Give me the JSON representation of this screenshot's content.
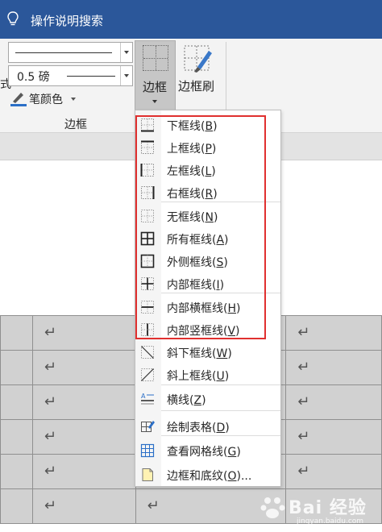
{
  "titlebar": {
    "title": "操作说明搜索",
    "icon": "lightbulb-icon"
  },
  "ribbon": {
    "style_fragment": "式",
    "pen_weight": "0.5 磅",
    "pen_color_label": "笔颜色",
    "borders_button_label": "边框",
    "border_painter_label": "边框刷",
    "group_label": "边框"
  },
  "borders_menu": {
    "items": [
      {
        "label": "下框线",
        "accel": "B",
        "icon": "bottom-border-icon"
      },
      {
        "label": "上框线",
        "accel": "P",
        "icon": "top-border-icon"
      },
      {
        "label": "左框线",
        "accel": "L",
        "icon": "left-border-icon"
      },
      {
        "label": "右框线",
        "accel": "R",
        "icon": "right-border-icon"
      },
      {
        "label": "无框线",
        "accel": "N",
        "icon": "no-border-icon"
      },
      {
        "label": "所有框线",
        "accel": "A",
        "icon": "all-borders-icon"
      },
      {
        "label": "外侧框线",
        "accel": "S",
        "icon": "outside-borders-icon"
      },
      {
        "label": "内部框线",
        "accel": "I",
        "icon": "inside-borders-icon"
      },
      {
        "label": "内部横框线",
        "accel": "H",
        "icon": "inside-horizontal-border-icon"
      },
      {
        "label": "内部竖框线",
        "accel": "V",
        "icon": "inside-vertical-border-icon"
      },
      {
        "label": "斜下框线",
        "accel": "W",
        "icon": "diagonal-down-border-icon"
      },
      {
        "label": "斜上框线",
        "accel": "U",
        "icon": "diagonal-up-border-icon"
      },
      {
        "label": "横线",
        "accel": "Z",
        "icon": "horizontal-line-icon"
      },
      {
        "label": "绘制表格",
        "accel": "D",
        "icon": "draw-table-icon"
      },
      {
        "label": "查看网格线",
        "accel": "G",
        "icon": "view-gridlines-icon"
      },
      {
        "label": "边框和底纹",
        "accel": "O",
        "suffix": "...",
        "icon": "borders-shading-icon"
      }
    ]
  },
  "document": {
    "paragraph_mark": "↵"
  },
  "watermark": {
    "text": "Bai 经验",
    "url": "jingyan.baidu.com"
  },
  "colors": {
    "titlebar": "#2b579a",
    "highlight": "#e0302f",
    "pen_color": "#2b6fc7"
  }
}
